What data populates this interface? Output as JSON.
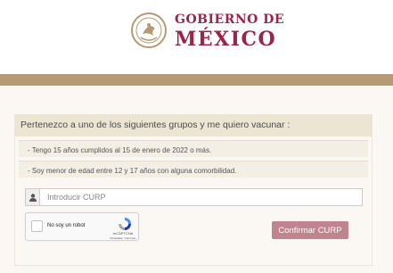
{
  "header": {
    "seal_icon": "coat-of-arms-icon",
    "brand_line1": "GOBIERNO DE",
    "brand_line2": "MÉXICO"
  },
  "colors": {
    "brand": "#9d2449",
    "gold": "#b49b73",
    "button": "#c0848e"
  },
  "groups": {
    "title": "Pertenezco a uno de los siguientes grupos y me quiero vacunar :",
    "items": [
      "- Tengo 15 años cumplidos al 15 de enero de 2022 o más.",
      "- Soy menor de edad entre 12 y 17 años con alguna comorbilidad."
    ]
  },
  "curp": {
    "icon": "user-icon",
    "placeholder": "Introducir CURP"
  },
  "recaptcha": {
    "label": "No soy un robot",
    "brand": "reCAPTCHA",
    "links": "Privacidad - Términos",
    "icon": "recaptcha-logo-icon"
  },
  "confirm": {
    "label": "Confirmar CURP"
  }
}
